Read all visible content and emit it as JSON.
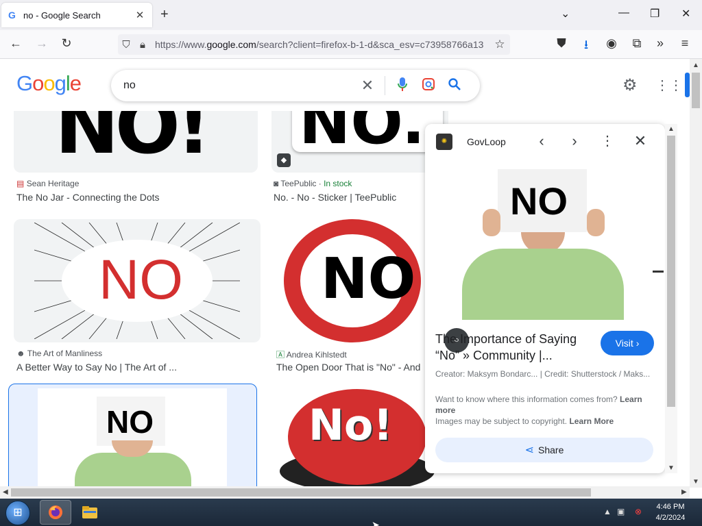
{
  "browser": {
    "tab_title": "no - Google Search",
    "tab_favicon": "G",
    "url_prefix": "https://www.",
    "url_domain": "google.com",
    "url_rest": "/search?client=firefox-b-1-d&sca_esv=c73958766a13"
  },
  "google": {
    "logo": [
      "G",
      "o",
      "o",
      "g",
      "l",
      "e"
    ],
    "query": "no"
  },
  "results": [
    {
      "source": "Sean Heritage",
      "title": "The No Jar - Connecting the Dots",
      "image_text": "NO!"
    },
    {
      "source": "TeePublic",
      "stock": "In stock",
      "title": "No. - No - Sticker | TeePublic",
      "image_text": "NO."
    },
    {
      "source": "The Art of Manliness",
      "title": "A Better Way to Say No | The Art of ...",
      "image_text": "NO"
    },
    {
      "source": "Andrea Kihlstedt",
      "title": "The Open Door That is \"No\" - And",
      "image_text": "NO"
    },
    {
      "image_text": "NO"
    },
    {
      "image_text": "No!"
    }
  ],
  "panel": {
    "site": "GovLoop",
    "image_text": "NO",
    "title": "The Importance of Saying “No” » Community |...",
    "visit_label": "Visit",
    "credit": "Creator: Maksym Bondarc... | Credit: Shutterstock / Maks...",
    "info_q": "Want to know where this information comes from?",
    "learn_more": "Learn more",
    "copyright": "Images may be subject to copyright.",
    "learn_more2": "Learn More",
    "share_label": "Share"
  },
  "taskbar": {
    "time": "4:46 PM",
    "date": "4/2/2024"
  },
  "colors": {
    "accent": "#1a73e8",
    "stock_green": "#188038",
    "red": "#d32f2f"
  }
}
